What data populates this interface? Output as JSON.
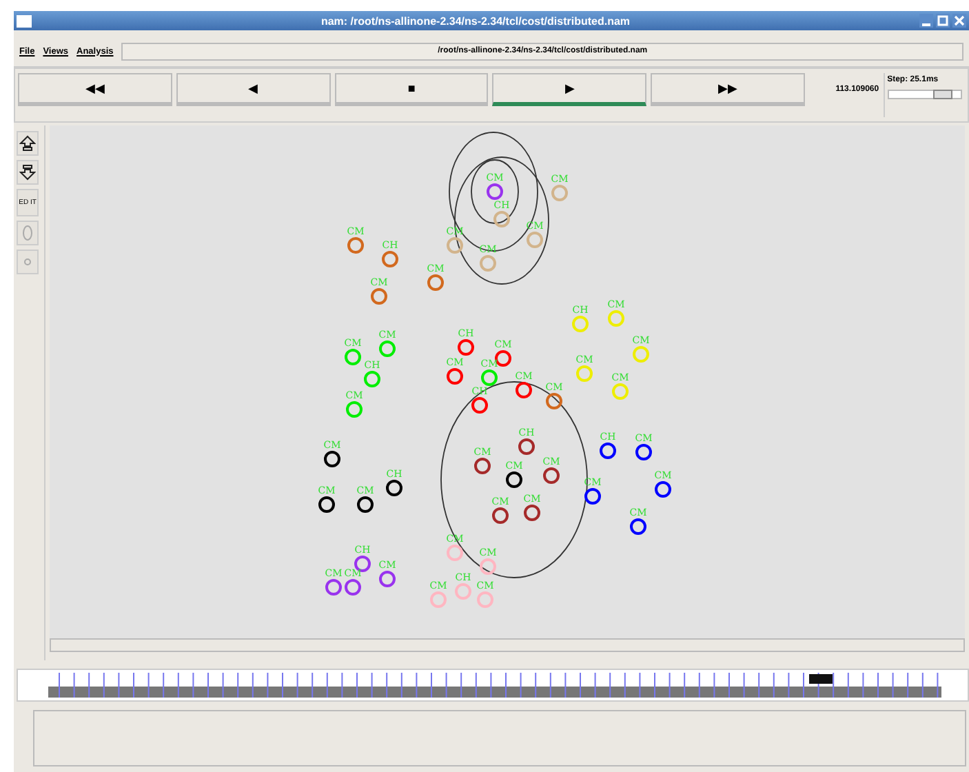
{
  "window": {
    "title": "nam: /root/ns-allinone-2.34/ns-2.34/tcl/cost/distributed.nam"
  },
  "menu": [
    "File",
    "Views",
    "Analysis"
  ],
  "path": "/root/ns-allinone-2.34/ns-2.34/tcl/cost/distributed.nam",
  "controls": [
    {
      "glyph": "◀◀",
      "selected": false
    },
    {
      "glyph": "◀",
      "selected": false
    },
    {
      "glyph": "■",
      "selected": false
    },
    {
      "glyph": "▶",
      "selected": true
    },
    {
      "glyph": "▶▶",
      "selected": false
    }
  ],
  "time": "113.109060",
  "step": {
    "label": "Step: 25.1ms",
    "level": 0.85
  },
  "edit_tool": "ED IT",
  "nodes": [
    {
      "label": "CM",
      "color": "#9933ee"
    },
    {
      "label": "CM",
      "color": "#d2b48c"
    },
    {
      "label": "CH",
      "color": "#d2b48c"
    },
    {
      "label": "CM",
      "color": "#d2b48c"
    },
    {
      "label": "CM",
      "color": "#d2b48c"
    },
    {
      "label": "CM",
      "color": "#d2b48c"
    },
    {
      "label": "CM",
      "color": "#d2691e"
    },
    {
      "label": "CH",
      "color": "#d2691e"
    },
    {
      "label": "CM",
      "color": "#d2691e"
    },
    {
      "label": "CM",
      "color": "#d2691e"
    },
    {
      "label": "CH",
      "color": "#eeee00"
    },
    {
      "label": "CM",
      "color": "#eeee00"
    },
    {
      "label": "CM",
      "color": "#eeee00"
    },
    {
      "label": "CM",
      "color": "#eeee00"
    },
    {
      "label": "CM",
      "color": "#eeee00"
    },
    {
      "label": "CM",
      "color": "#00ee00"
    },
    {
      "label": "CM",
      "color": "#00ee00"
    },
    {
      "label": "CH",
      "color": "#00ee00"
    },
    {
      "label": "CM",
      "color": "#00ee00"
    },
    {
      "label": "CH",
      "color": "#ff0000"
    },
    {
      "label": "CM",
      "color": "#ff0000"
    },
    {
      "label": "CM",
      "color": "#ff0000"
    },
    {
      "label": "CM",
      "color": "#00ee00"
    },
    {
      "label": "CM",
      "color": "#ff0000"
    },
    {
      "label": "CH",
      "color": "#ff0000"
    },
    {
      "label": "CM",
      "color": "#d2691e"
    },
    {
      "label": "CH",
      "color": "#a52a2a"
    },
    {
      "label": "CM",
      "color": "#a52a2a"
    },
    {
      "label": "CM",
      "color": "#000000"
    },
    {
      "label": "CM",
      "color": "#a52a2a"
    },
    {
      "label": "CM",
      "color": "#a52a2a"
    },
    {
      "label": "CM",
      "color": "#a52a2a"
    },
    {
      "label": "CM",
      "color": "#000000"
    },
    {
      "label": "CH",
      "color": "#000000"
    },
    {
      "label": "CM",
      "color": "#000000"
    },
    {
      "label": "CM",
      "color": "#000000"
    },
    {
      "label": "CH",
      "color": "#0000ff"
    },
    {
      "label": "CM",
      "color": "#0000ff"
    },
    {
      "label": "CM",
      "color": "#0000ff"
    },
    {
      "label": "CM",
      "color": "#0000ff"
    },
    {
      "label": "CM",
      "color": "#0000ff"
    },
    {
      "label": "CH",
      "color": "#9933ee"
    },
    {
      "label": "CM",
      "color": "#9933ee"
    },
    {
      "label": "CM",
      "color": "#9933ee"
    },
    {
      "label": "CM",
      "color": "#9933ee"
    },
    {
      "label": "CM",
      "color": "#ffb6c1"
    },
    {
      "label": "CM",
      "color": "#ffb6c1"
    },
    {
      "label": "CM",
      "color": "#ffb6c1"
    },
    {
      "label": "CH",
      "color": "#ffb6c1"
    },
    {
      "label": "CM",
      "color": "#ffb6c1"
    }
  ]
}
